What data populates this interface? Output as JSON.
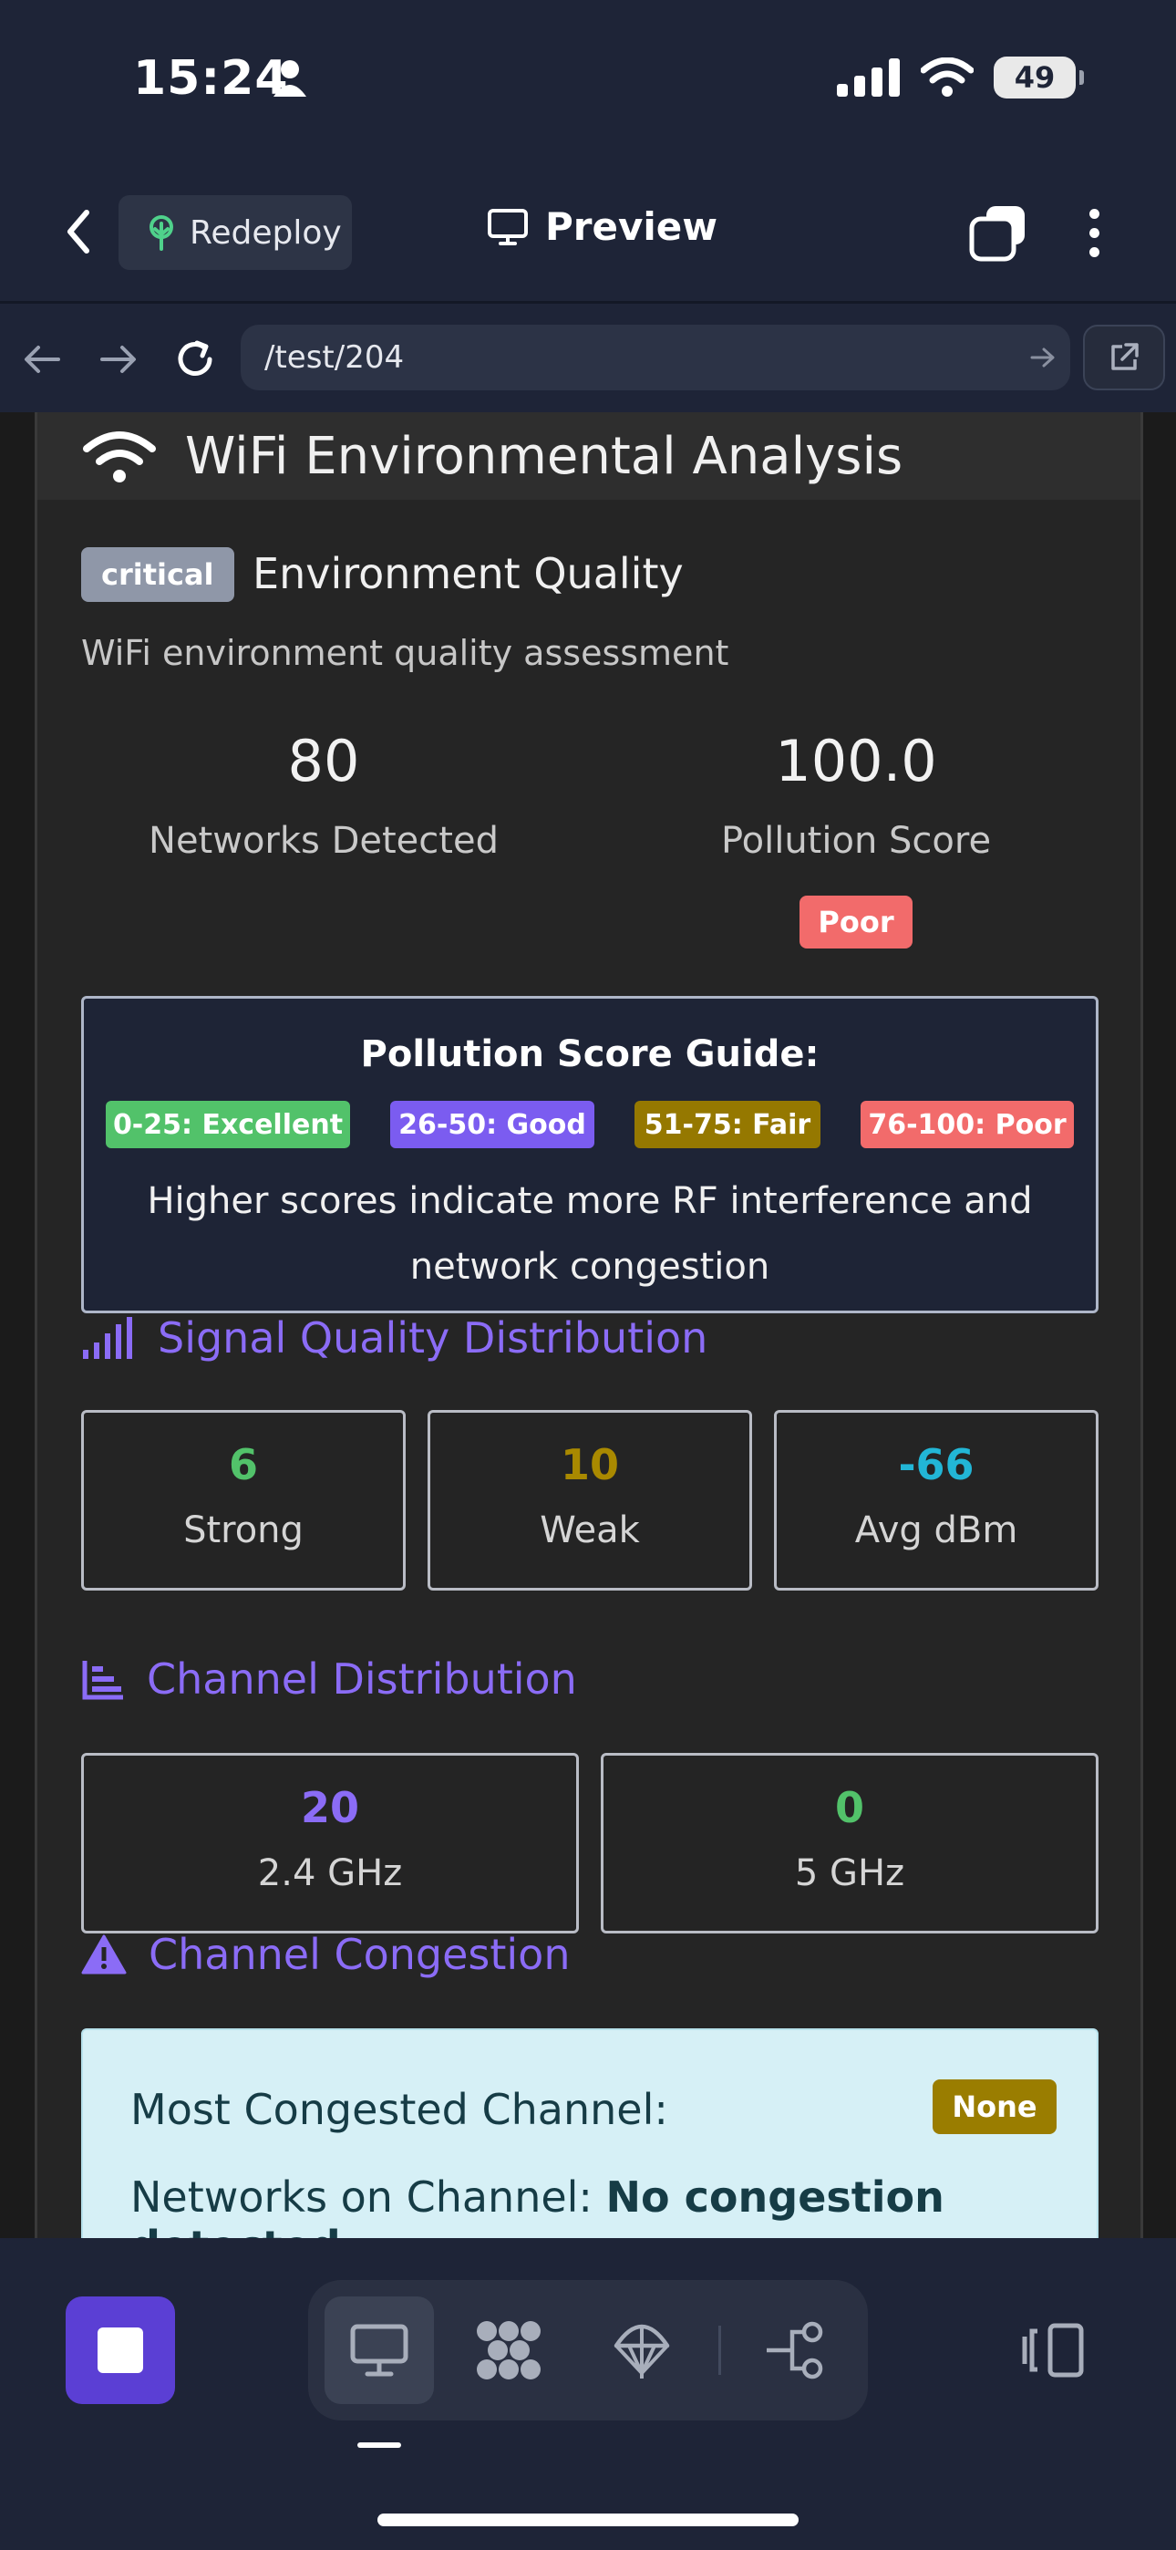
{
  "status_bar": {
    "time": "15:24",
    "battery": "49"
  },
  "top_nav": {
    "redeploy_label": "Redeploy",
    "preview_label": "Preview"
  },
  "url_bar": {
    "url": "/test/204"
  },
  "card": {
    "title": "WiFi Environmental Analysis",
    "severity_badge": "critical",
    "section_title": "Environment Quality",
    "subtitle": "WiFi environment quality assessment",
    "stats": {
      "networks_value": "80",
      "networks_label": "Networks Detected",
      "pollution_value": "100.0",
      "pollution_label": "Pollution Score",
      "pollution_badge": "Poor"
    },
    "guide": {
      "title": "Pollution Score Guide:",
      "chips": [
        "0-25: Excellent",
        "26-50: Good",
        "51-75: Fair",
        "76-100: Poor"
      ],
      "chip_colors": [
        "#52c26a",
        "#7b5cf0",
        "#957800",
        "#f26b6b"
      ],
      "note": "Higher scores indicate more RF interference and network congestion"
    },
    "signal": {
      "title": "Signal Quality Distribution",
      "boxes": [
        {
          "value": "6",
          "label": "Strong",
          "color": "#52c26a"
        },
        {
          "value": "10",
          "label": "Weak",
          "color": "#a98900"
        },
        {
          "value": "-66",
          "label": "Avg dBm",
          "color": "#22b6d6"
        }
      ]
    },
    "channel": {
      "title": "Channel Distribution",
      "boxes": [
        {
          "value": "20",
          "label": "2.4 GHz",
          "color": "#8b6cf6"
        },
        {
          "value": "0",
          "label": "5 GHz",
          "color": "#52c26a"
        }
      ]
    },
    "congestion": {
      "title": "Channel Congestion",
      "most_label": "Most Congested Channel:",
      "most_value": "None",
      "networks_label": "Networks on Channel:",
      "networks_value": "No congestion detected"
    }
  },
  "colors": {
    "accent": "#8b6cf6",
    "background": "#1e2437",
    "card": "#252525"
  }
}
